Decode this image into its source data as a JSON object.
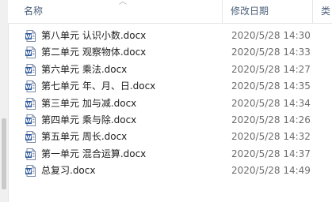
{
  "columns": {
    "name": "名称",
    "date_modified": "修改日期",
    "type": "类"
  },
  "files": [
    {
      "name": "第八单元  认识小数.docx",
      "modified": "2020/5/28 14:30",
      "icon": "word-document-icon"
    },
    {
      "name": "第二单元  观察物体.docx",
      "modified": "2020/5/28 14:33",
      "icon": "word-document-icon"
    },
    {
      "name": "第六单元   乘法.docx",
      "modified": "2020/5/28 14:27",
      "icon": "word-document-icon"
    },
    {
      "name": "第七单元  年、月、日.docx",
      "modified": "2020/5/28 14:35",
      "icon": "word-document-icon"
    },
    {
      "name": "第三单元  加与减.docx",
      "modified": "2020/5/28 14:34",
      "icon": "word-document-icon"
    },
    {
      "name": "第四单元  乘与除.docx",
      "modified": "2020/5/28 14:26",
      "icon": "word-document-icon"
    },
    {
      "name": "第五单元  周长.docx",
      "modified": "2020/5/28 14:32",
      "icon": "word-document-icon"
    },
    {
      "name": "第一单元  混合运算.docx",
      "modified": "2020/5/28 14:37",
      "icon": "word-document-icon"
    },
    {
      "name": "总复习.docx",
      "modified": "2020/5/28 14:49",
      "icon": "word-document-icon"
    }
  ],
  "colors": {
    "header_text": "#4c607a",
    "word_icon_blue": "#2b579a",
    "date_text": "#6d6d6d"
  }
}
